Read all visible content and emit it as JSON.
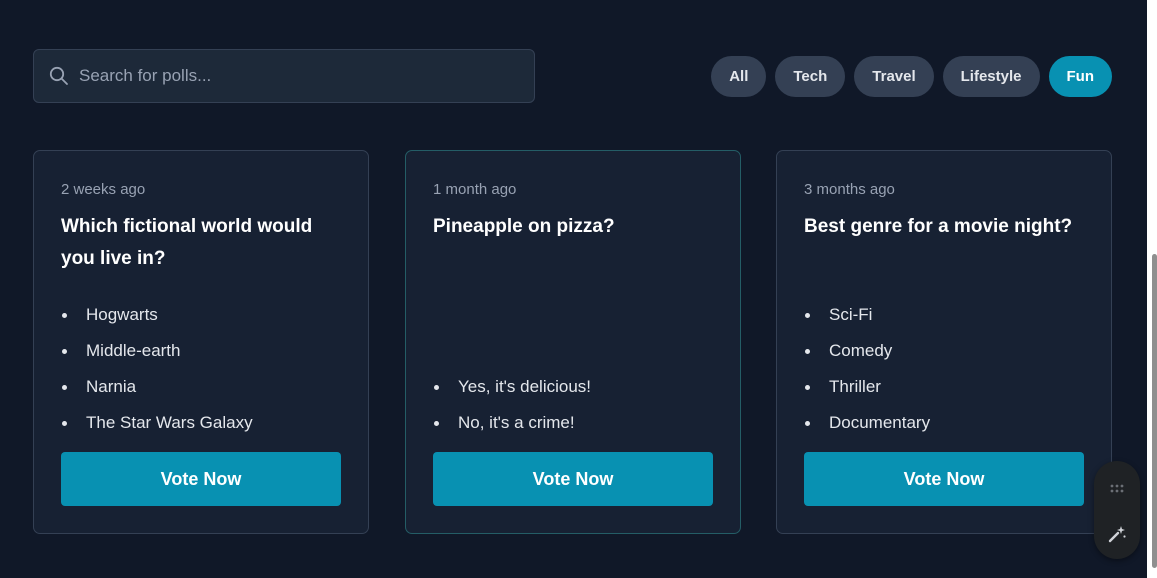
{
  "search": {
    "placeholder": "Search for polls...",
    "value": ""
  },
  "filters": [
    {
      "label": "All",
      "active": false
    },
    {
      "label": "Tech",
      "active": false
    },
    {
      "label": "Travel",
      "active": false
    },
    {
      "label": "Lifestyle",
      "active": false
    },
    {
      "label": "Fun",
      "active": true
    }
  ],
  "polls": [
    {
      "time": "2 weeks ago",
      "question": "Which fictional world would you live in?",
      "options": [
        "Hogwarts",
        "Middle-earth",
        "Narnia",
        "The Star Wars Galaxy"
      ],
      "vote_label": "Vote Now"
    },
    {
      "time": "1 month ago",
      "question": "Pineapple on pizza?",
      "options": [
        "Yes, it's delicious!",
        "No, it's a crime!"
      ],
      "vote_label": "Vote Now"
    },
    {
      "time": "3 months ago",
      "question": "Best genre for a movie night?",
      "options": [
        "Sci-Fi",
        "Comedy",
        "Thriller",
        "Documentary"
      ],
      "vote_label": "Vote Now"
    }
  ],
  "colors": {
    "background": "#101828",
    "card": "#172133",
    "accent": "#0891b2",
    "chip": "#344054"
  },
  "icons": {
    "search": "search-icon",
    "drag": "drag-handle-icon",
    "sparkle": "sparkle-icon"
  }
}
